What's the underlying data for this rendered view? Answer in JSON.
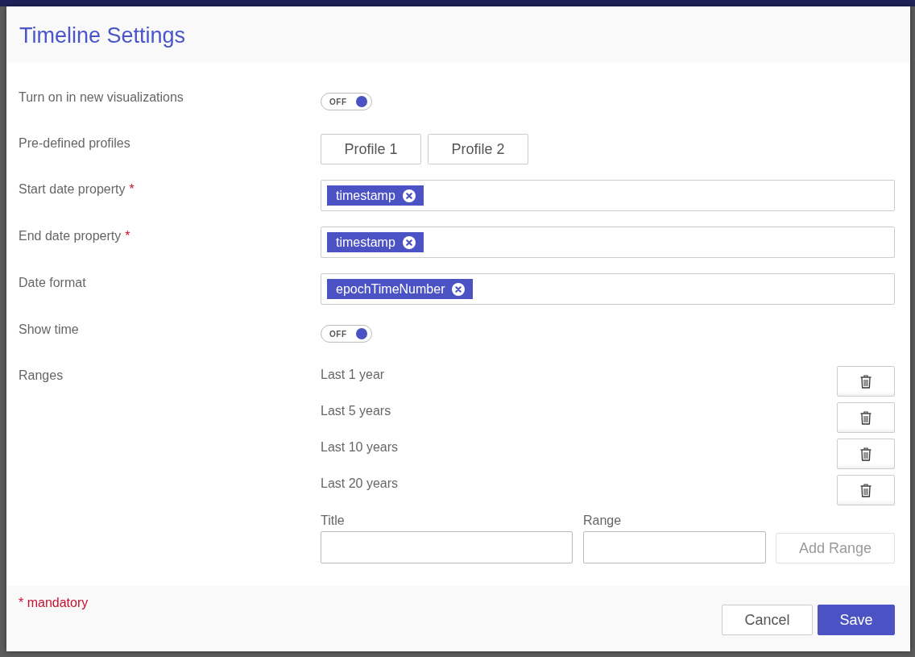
{
  "dialog": {
    "title": "Timeline Settings"
  },
  "fields": [
    {
      "kind": "toggle",
      "label": "Turn on in new visualizations",
      "on": false,
      "switch_text": "OFF"
    },
    {
      "kind": "buttons",
      "label": "Pre-defined profiles",
      "buttons": [
        "Profile 1",
        "Profile 2"
      ]
    },
    {
      "kind": "tags",
      "label": "Start date property",
      "required_mark": "*",
      "tags": [
        "timestamp"
      ]
    },
    {
      "kind": "tags",
      "label": "End date property",
      "required_mark": "*",
      "tags": [
        "timestamp"
      ]
    },
    {
      "kind": "tags",
      "label": "Date format",
      "tags": [
        "epochTimeNumber"
      ]
    },
    {
      "kind": "toggle",
      "label": "Show time",
      "on": false,
      "switch_text": "OFF"
    },
    {
      "kind": "ranges",
      "label": "Ranges",
      "ranges": [
        "Last 1 year",
        "Last 5 years",
        "Last 10 years",
        "Last 20 years"
      ],
      "new_range": {
        "title_label": "Title",
        "range_label": "Range",
        "add_button": {
          "label": "Add Range",
          "disabled": true
        }
      }
    }
  ],
  "footer": {
    "note": "* mandatory",
    "buttons": [
      {
        "label": "Cancel",
        "kind": "secondary"
      },
      {
        "label": "Save",
        "kind": "primary"
      }
    ]
  }
}
